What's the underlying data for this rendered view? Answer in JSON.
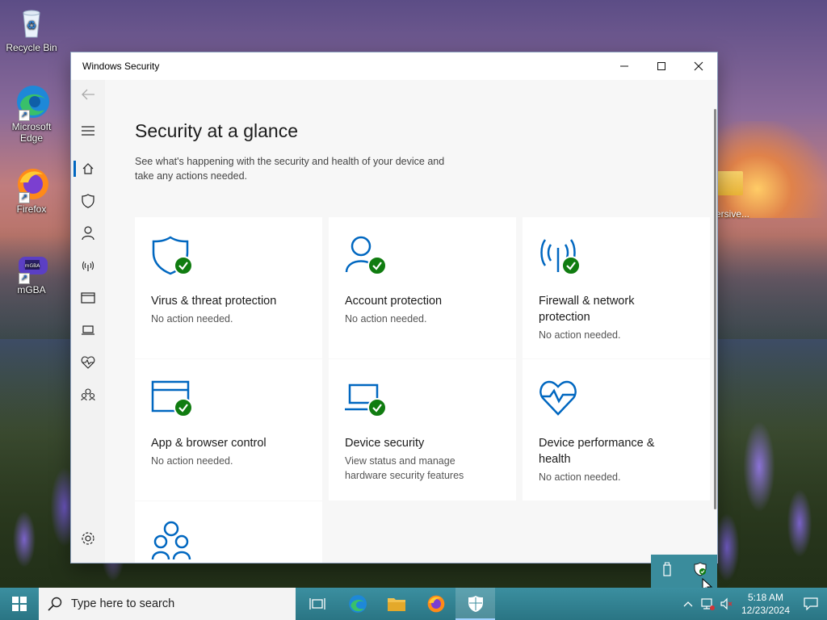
{
  "desktop": {
    "icons": [
      {
        "label": "Recycle Bin",
        "icon": "recycle-bin-icon"
      },
      {
        "label": "Microsoft Edge",
        "icon": "edge-icon"
      },
      {
        "label": "Firefox",
        "icon": "firefox-icon"
      },
      {
        "label": "mGBA",
        "icon": "mgba-icon"
      }
    ],
    "partial_folder_label": "ersive..."
  },
  "window": {
    "title": "Windows Security",
    "controls": {
      "minimize": "—",
      "maximize": "☐",
      "close": "✕"
    }
  },
  "nav": {
    "items": [
      {
        "name": "back",
        "icon": "back-arrow-icon"
      },
      {
        "name": "menu",
        "icon": "hamburger-menu-icon"
      },
      {
        "name": "home",
        "icon": "home-icon",
        "active": true
      },
      {
        "name": "virus-protection",
        "icon": "shield-icon"
      },
      {
        "name": "account-protection",
        "icon": "person-icon"
      },
      {
        "name": "firewall",
        "icon": "wireless-antenna-icon"
      },
      {
        "name": "app-browser",
        "icon": "browser-window-icon"
      },
      {
        "name": "device-security",
        "icon": "laptop-icon"
      },
      {
        "name": "device-performance",
        "icon": "heart-pulse-icon"
      },
      {
        "name": "family-options",
        "icon": "family-icon"
      },
      {
        "name": "settings",
        "icon": "gear-icon"
      }
    ]
  },
  "main": {
    "title": "Security at a glance",
    "description": "See what's happening with the security and health of your device and take any actions needed.",
    "cards": [
      {
        "title": "Virus & threat protection",
        "status": "No action needed.",
        "icon": "shield-icon"
      },
      {
        "title": "Account protection",
        "status": "No action needed.",
        "icon": "person-icon"
      },
      {
        "title": "Firewall & network protection",
        "status": "No action needed.",
        "icon": "wireless-antenna-icon"
      },
      {
        "title": "App & browser control",
        "status": "No action needed.",
        "icon": "browser-window-icon"
      },
      {
        "title": "Device security",
        "status": "View status and manage hardware security features",
        "icon": "laptop-icon"
      },
      {
        "title": "Device performance & health",
        "status": "No action needed.",
        "icon": "heart-pulse-icon"
      },
      {
        "title": "",
        "status": "",
        "icon": "family-icon"
      }
    ]
  },
  "taskbar": {
    "search_placeholder": "Type here to search",
    "apps": [
      "task-view-icon",
      "edge-icon",
      "file-explorer-icon",
      "firefox-icon",
      "windows-security-icon"
    ],
    "clock": {
      "time": "5:18 AM",
      "date": "12/23/2024"
    }
  },
  "colors": {
    "accent": "#0067c0",
    "check_green": "#107c10",
    "taskbar": "#2b7f8f"
  }
}
